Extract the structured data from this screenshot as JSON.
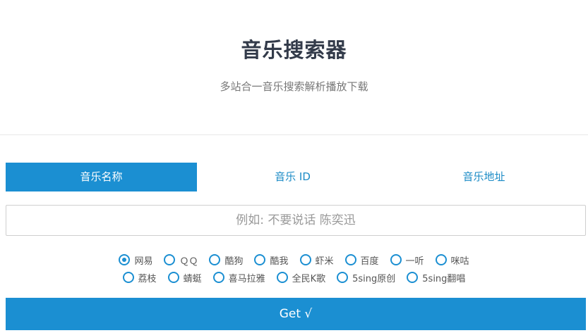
{
  "header": {
    "title": "音乐搜索器",
    "subtitle": "多站合一音乐搜索解析播放下载"
  },
  "tabs": [
    {
      "label": "音乐名称",
      "active": true
    },
    {
      "label": "音乐 ID",
      "active": false
    },
    {
      "label": "音乐地址",
      "active": false
    }
  ],
  "search": {
    "placeholder": "例如: 不要说话 陈奕迅",
    "value": ""
  },
  "sites": {
    "row1": [
      "网易",
      "ＱＱ",
      "酷狗",
      "酷我",
      "虾米",
      "百度",
      "一听",
      "咪咕"
    ],
    "row2": [
      "荔枝",
      "蜻蜓",
      "喜马拉雅",
      "全民K歌",
      "5sing原创",
      "5sing翻唱"
    ],
    "selected": "网易"
  },
  "submit": {
    "label": "Get √"
  },
  "colors": {
    "accent": "#1b8fd2",
    "title": "#333b4a"
  }
}
